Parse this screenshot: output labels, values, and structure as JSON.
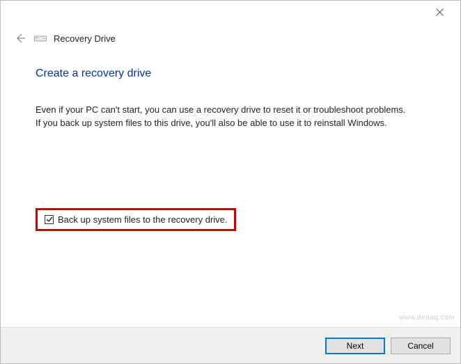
{
  "titlebar": {
    "close_tooltip": "Close"
  },
  "breadcrumb": {
    "title": "Recovery Drive"
  },
  "content": {
    "heading": "Create a recovery drive",
    "description": "Even if your PC can't start, you can use a recovery drive to reset it or troubleshoot problems. If you back up system files to this drive, you'll also be able to use it to reinstall Windows."
  },
  "checkbox": {
    "checked": true,
    "label": "Back up system files to the recovery drive."
  },
  "footer": {
    "next_label": "Next",
    "cancel_label": "Cancel"
  },
  "watermark": "www.deuaq.com"
}
